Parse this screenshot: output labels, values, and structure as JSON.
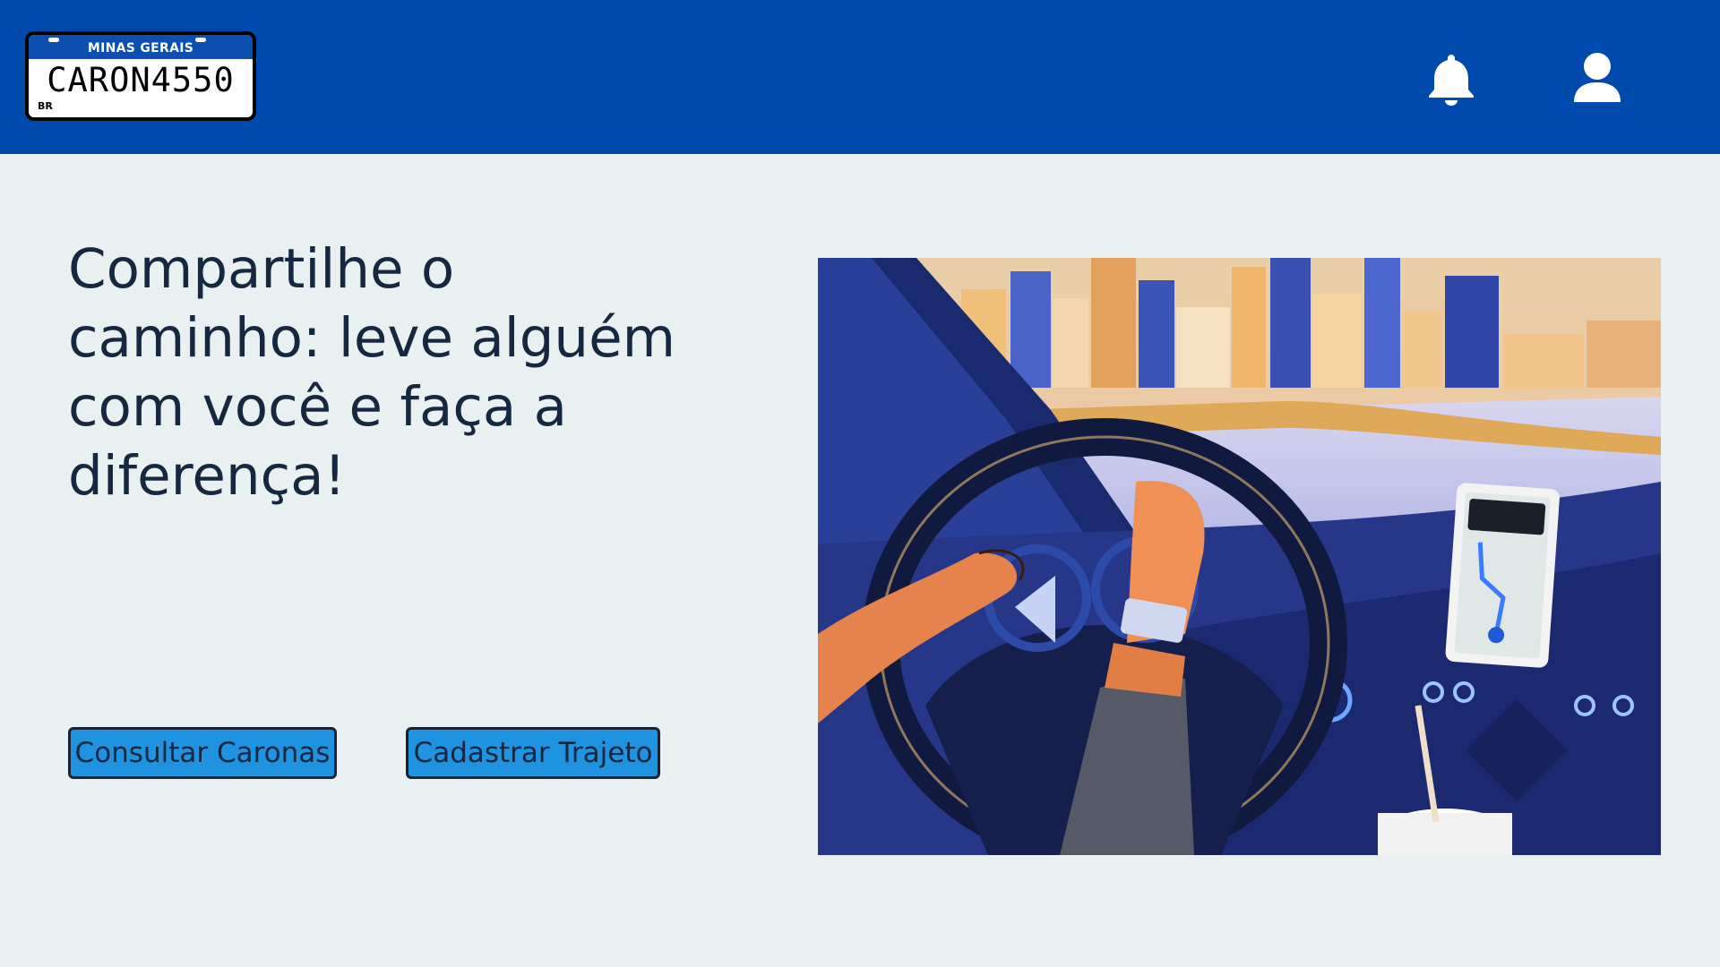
{
  "header": {
    "logo": {
      "state": "MINAS GERAIS",
      "plate_text": "CARON4550",
      "country": "BR"
    },
    "icons": {
      "notifications": "bell-icon",
      "profile": "user-icon"
    },
    "colors": {
      "background": "#014aad",
      "icon": "#ffffff"
    }
  },
  "main": {
    "headline_lines": [
      "Compartilhe o",
      "caminho: leve alguém",
      "com você e faça a",
      "diferença!"
    ],
    "buttons": {
      "consultar_label": "Consultar Caronas",
      "cadastrar_label": "Cadastrar Trajeto"
    },
    "colors": {
      "background": "#e8f0f1",
      "button": "#1f92e0",
      "text": "#16283f"
    }
  }
}
